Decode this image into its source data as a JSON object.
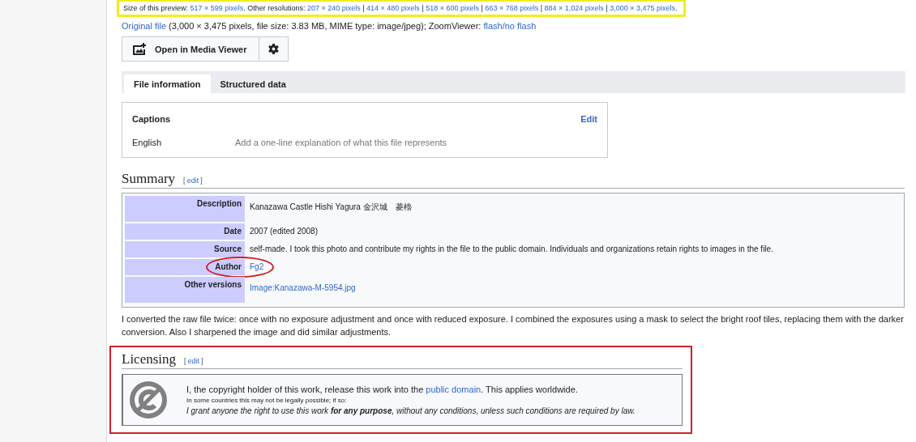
{
  "preview_line": [
    {
      "text": "Size of this preview: ",
      "link": false
    },
    {
      "text": "517 × 599 pixels",
      "link": true
    },
    {
      "text": ". Other resolutions: ",
      "link": false
    },
    {
      "text": "207 × 240 pixels",
      "link": true
    },
    {
      "text": " | ",
      "link": false
    },
    {
      "text": "414 × 480 pixels",
      "link": true
    },
    {
      "text": " | ",
      "link": false
    },
    {
      "text": "518 × 600 pixels",
      "link": true
    },
    {
      "text": " | ",
      "link": false
    },
    {
      "text": "663 × 768 pixels",
      "link": true
    },
    {
      "text": " | ",
      "link": false
    },
    {
      "text": "884 × 1,024 pixels",
      "link": true
    },
    {
      "text": " | ",
      "link": false
    },
    {
      "text": "3,000 × 3,475 pixels",
      "link": true
    }
  ],
  "preview_line_end": ".",
  "original_line": [
    {
      "text": "Original file",
      "link": true
    },
    {
      "text": " (3,000 × 3,475 pixels, file size: 3.83 MB, MIME type: image/jpeg); ZoomViewer: ",
      "link": false
    },
    {
      "text": "flash/no flash",
      "link": true
    }
  ],
  "media_viewer_button": "Open in Media Viewer",
  "tabs": [
    {
      "label": "File information",
      "selected": true
    },
    {
      "label": "Structured data",
      "selected": false
    }
  ],
  "captions": {
    "title": "Captions",
    "edit": "Edit",
    "language": "English",
    "placeholder": "Add a one-line explanation of what this file represents"
  },
  "summary": {
    "heading": "Summary",
    "edit_open": "[",
    "edit": "edit",
    "edit_close": "]",
    "rows": [
      {
        "label": "Description",
        "value": "Kanazawa Castle Hishi Yagura 金沢城　菱櫓",
        "link": false,
        "tall": true
      },
      {
        "label": "Date",
        "value": "2007 (edited 2008)",
        "link": false,
        "tall": false
      },
      {
        "label": "Source",
        "value": "self-made. I took this photo and contribute my rights in the file to the public domain. Individuals and organizations retain rights to images in the file.",
        "link": false,
        "tall": false
      },
      {
        "label": "Author",
        "value": "Fg2",
        "link": true,
        "tall": false
      },
      {
        "label": "Other versions",
        "value": "Image:Kanazawa-M-5954.jpg",
        "link": true,
        "tall": true
      }
    ],
    "note": "I converted the raw file twice: once with no exposure adjustment and once with reduced exposure. I combined the exposures using a mask to select the bright roof tiles, replacing them with the darker conversion. Also I sharpened the image and did similar adjustments."
  },
  "licensing": {
    "heading": "Licensing",
    "edit_open": "[",
    "edit": "edit",
    "edit_close": "]",
    "statement": [
      {
        "text": "I, the copyright holder of this work, release this work into the ",
        "link": false
      },
      {
        "text": "public domain",
        "link": true
      },
      {
        "text": ". This applies worldwide.",
        "link": false
      }
    ],
    "caveat": "In some countries this may not be legally possible; if so:",
    "grant": "I grant anyone the right to use this work **for any purpose**, without any conditions, unless such conditions are required by law."
  }
}
